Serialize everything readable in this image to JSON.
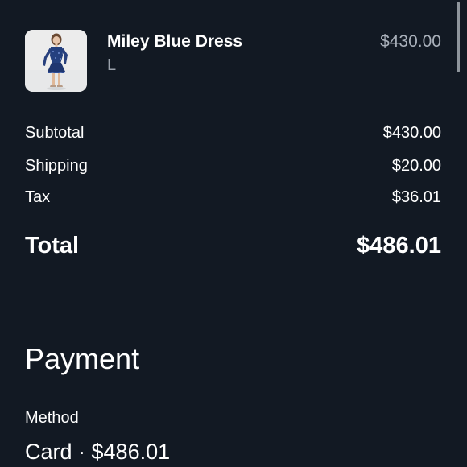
{
  "order_item": {
    "name": "Miley Blue Dress",
    "variant": "L",
    "price": "$430.00"
  },
  "summary": {
    "subtotal_label": "Subtotal",
    "subtotal_value": "$430.00",
    "shipping_label": "Shipping",
    "shipping_value": "$20.00",
    "tax_label": "Tax",
    "tax_value": "$36.01",
    "total_label": "Total",
    "total_value": "$486.01"
  },
  "payment": {
    "heading": "Payment",
    "method_label": "Method",
    "method_value": "Card · $486.01"
  },
  "colors": {
    "background": "#121923",
    "text": "#ffffff",
    "muted_text": "#a9b0ba",
    "dress_blue": "#24407f"
  }
}
